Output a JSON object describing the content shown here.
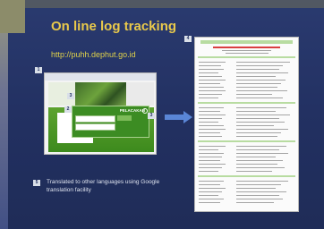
{
  "slide": {
    "title": "On line log tracking",
    "url": "http://puhh.dephut.go.id",
    "caption": "Translated to other languages using Google translation facility"
  },
  "badges": {
    "b1": "1",
    "b2": "2",
    "b3": "3",
    "b3b": "3",
    "b4": "4",
    "b5": "5"
  },
  "search_panel": {
    "title": "PELACAKAN"
  }
}
